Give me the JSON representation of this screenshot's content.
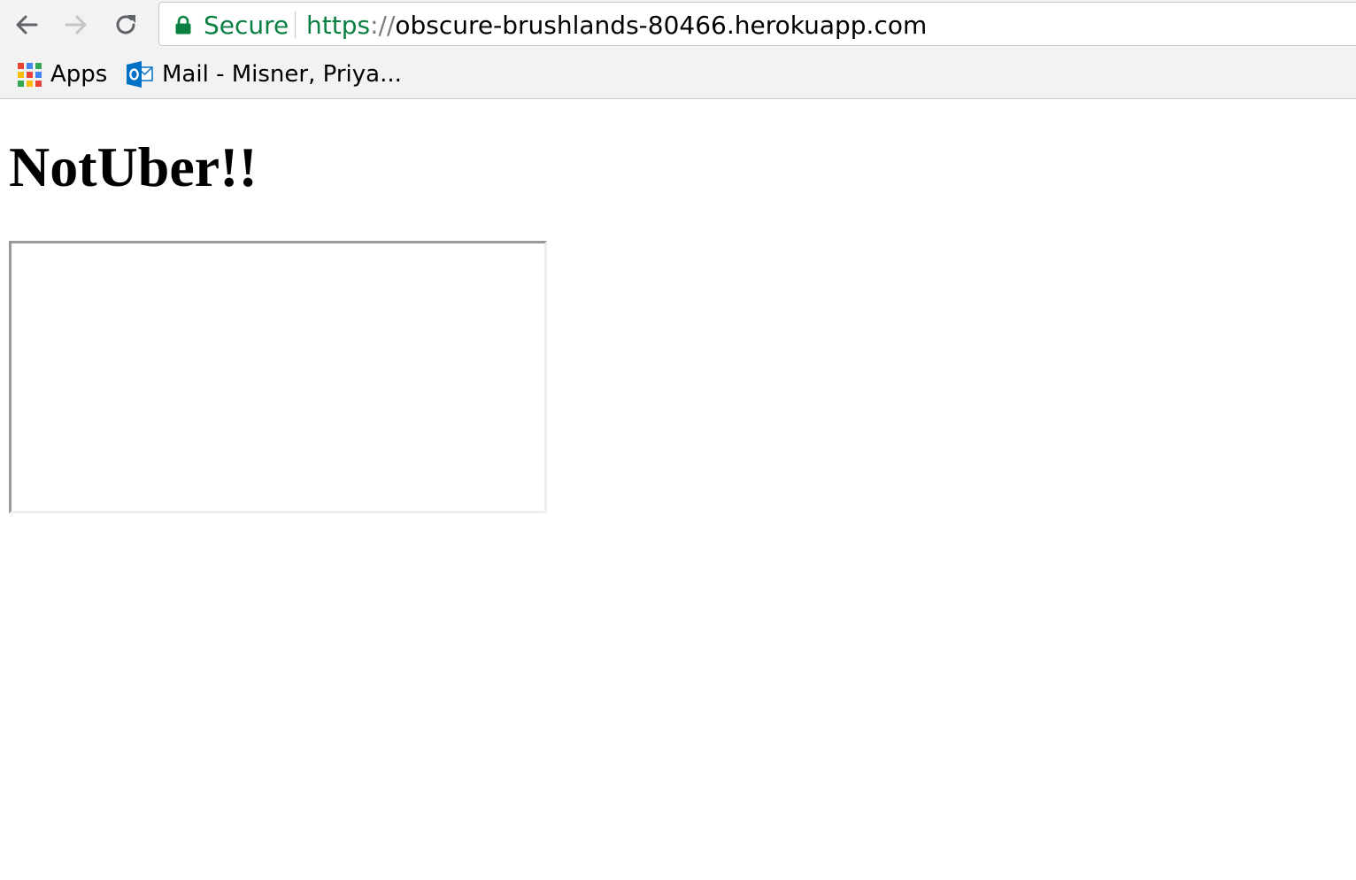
{
  "browser": {
    "omnibox": {
      "security_label": "Secure",
      "url_scheme": "https",
      "url_separator": "://",
      "url_host": "obscure-brushlands-80466.herokuapp.com",
      "secure_color": "#0b8043"
    },
    "nav": {
      "back_icon": "arrow-left-icon",
      "forward_icon": "arrow-right-icon",
      "reload_icon": "reload-icon"
    },
    "bookmarks": [
      {
        "label": "Apps",
        "icon": "apps-grid-icon"
      },
      {
        "label": "Mail - Misner, Priya...",
        "icon": "outlook-icon"
      }
    ]
  },
  "page": {
    "title": "NotUber!!"
  }
}
